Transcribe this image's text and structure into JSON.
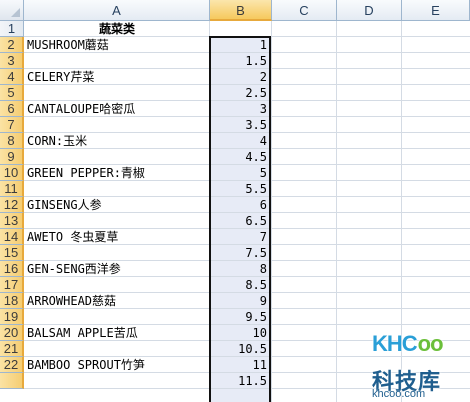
{
  "columns": [
    {
      "label": "A",
      "selected": false
    },
    {
      "label": "B",
      "selected": true
    },
    {
      "label": "C",
      "selected": false
    },
    {
      "label": "D",
      "selected": false
    },
    {
      "label": "E",
      "selected": false
    }
  ],
  "header_cell": "蔬菜类",
  "rows": [
    {
      "num": "1",
      "a": "",
      "b": ""
    },
    {
      "num": "2",
      "a": "MUSHROOM蘑菇",
      "b": "1"
    },
    {
      "num": "3",
      "a": "",
      "b": "1.5"
    },
    {
      "num": "4",
      "a": "CELERY芹菜",
      "b": "2"
    },
    {
      "num": "5",
      "a": "",
      "b": "2.5"
    },
    {
      "num": "6",
      "a": "CANTALOUPE哈密瓜",
      "b": "3"
    },
    {
      "num": "7",
      "a": "",
      "b": "3.5"
    },
    {
      "num": "8",
      "a": "CORN:玉米",
      "b": "4"
    },
    {
      "num": "9",
      "a": "",
      "b": "4.5"
    },
    {
      "num": "10",
      "a": "GREEN PEPPER:青椒",
      "b": "5"
    },
    {
      "num": "11",
      "a": "",
      "b": "5.5"
    },
    {
      "num": "12",
      "a": "GINSENG人参",
      "b": "6"
    },
    {
      "num": "13",
      "a": "",
      "b": "6.5"
    },
    {
      "num": "14",
      "a": "AWETO 冬虫夏草",
      "b": "7"
    },
    {
      "num": "15",
      "a": "",
      "b": "7.5"
    },
    {
      "num": "16",
      "a": "GEN-SENG西洋参",
      "b": "8"
    },
    {
      "num": "17",
      "a": "",
      "b": "8.5"
    },
    {
      "num": "18",
      "a": "ARROWHEAD慈菇",
      "b": "9"
    },
    {
      "num": "19",
      "a": "",
      "b": "9.5"
    },
    {
      "num": "20",
      "a": "BALSAM APPLE苦瓜",
      "b": "10"
    },
    {
      "num": "21",
      "a": "",
      "b": "10.5"
    },
    {
      "num": "22",
      "a": "BAMBOO SPROUT竹笋",
      "b": "11"
    },
    {
      "num": "",
      "a": "",
      "b": "11.5"
    }
  ],
  "watermark": {
    "logo_parts": [
      "KHC",
      "oo"
    ],
    "chinese": "科技库",
    "url": "khcoo.com"
  }
}
